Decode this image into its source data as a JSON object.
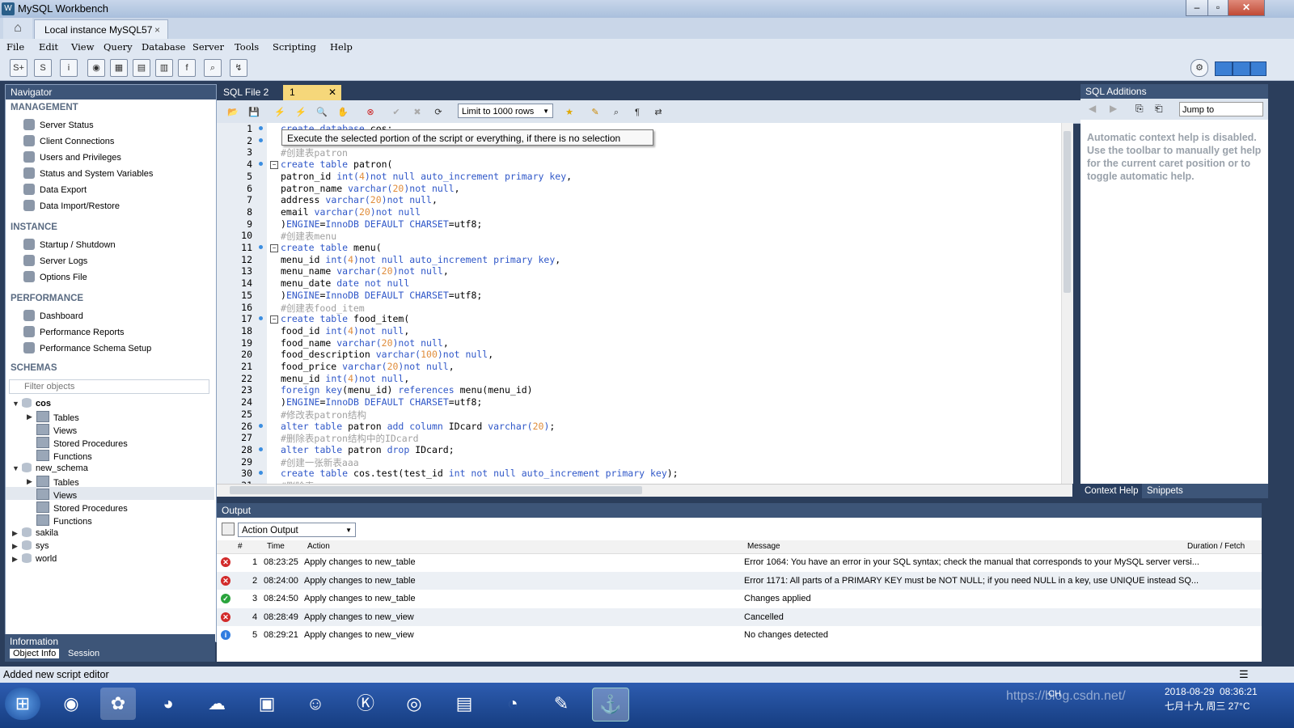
{
  "window": {
    "title": "MySQL Workbench"
  },
  "tabs": {
    "connection": "Local instance MySQL57",
    "close": "×"
  },
  "menu": [
    "File",
    "Edit",
    "View",
    "Query",
    "Database",
    "Server",
    "Tools",
    "Scripting",
    "Help"
  ],
  "navigator": {
    "header": "Navigator",
    "management": {
      "title": "MANAGEMENT",
      "items": [
        "Server Status",
        "Client Connections",
        "Users and Privileges",
        "Status and System Variables",
        "Data Export",
        "Data Import/Restore"
      ]
    },
    "instance": {
      "title": "INSTANCE",
      "items": [
        "Startup / Shutdown",
        "Server Logs",
        "Options File"
      ]
    },
    "performance": {
      "title": "PERFORMANCE",
      "items": [
        "Dashboard",
        "Performance Reports",
        "Performance Schema Setup"
      ]
    },
    "schemas": {
      "title": "SCHEMAS",
      "filter_placeholder": "Filter objects",
      "cos": {
        "name": "cos",
        "children": [
          "Tables",
          "Views",
          "Stored Procedures",
          "Functions"
        ]
      },
      "new_schema": {
        "name": "new_schema",
        "children": [
          "Tables",
          "Views",
          "Stored Procedures",
          "Functions"
        ]
      },
      "others": [
        "sakila",
        "sys",
        "world"
      ]
    }
  },
  "information": {
    "header": "Information",
    "tabs": [
      "Object Info",
      "Session"
    ]
  },
  "editor": {
    "tabs": [
      "SQL File 2",
      "1"
    ],
    "limit": "Limit to 1000 rows",
    "tooltip": "Execute the selected portion of the script or everything, if there is no selection",
    "line_numbers": [
      "1",
      "2",
      "3",
      "4",
      "5",
      "6",
      "7",
      "8",
      "9",
      "10",
      "11",
      "12",
      "13",
      "14",
      "15",
      "16",
      "17",
      "18",
      "19",
      "20",
      "21",
      "22",
      "23",
      "24",
      "25",
      "26",
      "27",
      "28",
      "29",
      "30",
      "31"
    ]
  },
  "sql_additions": {
    "header": "SQL Additions",
    "jump_to": "Jump to",
    "help_text": "Automatic context help is disabled. Use the toolbar to manually get help for the current caret position or to toggle automatic help.",
    "tabs": [
      "Context Help",
      "Snippets"
    ]
  },
  "output": {
    "header": "Output",
    "selector": "Action Output",
    "columns": {
      "num": "#",
      "time": "Time",
      "action": "Action",
      "message": "Message",
      "duration": "Duration / Fetch"
    },
    "rows": [
      {
        "n": "1",
        "time": "08:23:25",
        "action": "Apply changes to new_table",
        "message": "Error 1064: You have an error in your SQL syntax; check the manual that corresponds to your MySQL server versi...",
        "status": "error"
      },
      {
        "n": "2",
        "time": "08:24:00",
        "action": "Apply changes to new_table",
        "message": "Error 1171: All parts of a PRIMARY KEY must be NOT NULL; if you need NULL in a key, use UNIQUE instead SQ...",
        "status": "error"
      },
      {
        "n": "3",
        "time": "08:24:50",
        "action": "Apply changes to new_table",
        "message": "Changes applied",
        "status": "ok"
      },
      {
        "n": "4",
        "time": "08:28:49",
        "action": "Apply changes to new_view",
        "message": "Cancelled",
        "status": "error"
      },
      {
        "n": "5",
        "time": "08:29:21",
        "action": "Apply changes to new_view",
        "message": "No changes detected",
        "status": "info"
      }
    ]
  },
  "status_bar": {
    "message": "Added new script editor"
  },
  "taskbar": {
    "lang": "CH",
    "date": "2018-08-29",
    "time": "08:36:21",
    "lunar": "七月十九 周三 27°C",
    "watermark": "https://blog.csdn.net/"
  }
}
